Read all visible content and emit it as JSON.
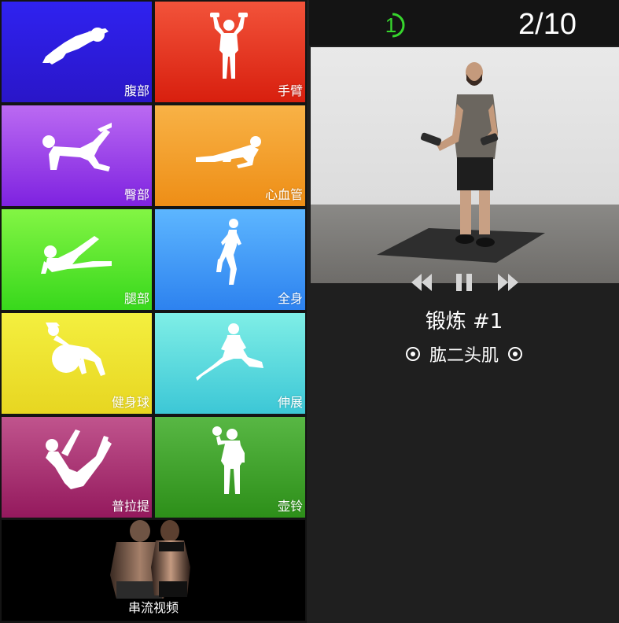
{
  "categories": [
    {
      "key": "abs",
      "label": "腹部"
    },
    {
      "key": "arms",
      "label": "手臂"
    },
    {
      "key": "butt",
      "label": "臀部"
    },
    {
      "key": "cardio",
      "label": "心血管"
    },
    {
      "key": "legs",
      "label": "腿部"
    },
    {
      "key": "full",
      "label": "全身"
    },
    {
      "key": "ball",
      "label": "健身球"
    },
    {
      "key": "stretch",
      "label": "伸展"
    },
    {
      "key": "pilates",
      "label": "普拉提"
    },
    {
      "key": "kettle",
      "label": "壶铃"
    }
  ],
  "streaming": {
    "label": "串流视频"
  },
  "player": {
    "timer_value": "1",
    "progress": "2/10",
    "exercise_title": "锻炼 #1",
    "muscle": "肱二头肌",
    "timer_color": "#37d62d"
  }
}
